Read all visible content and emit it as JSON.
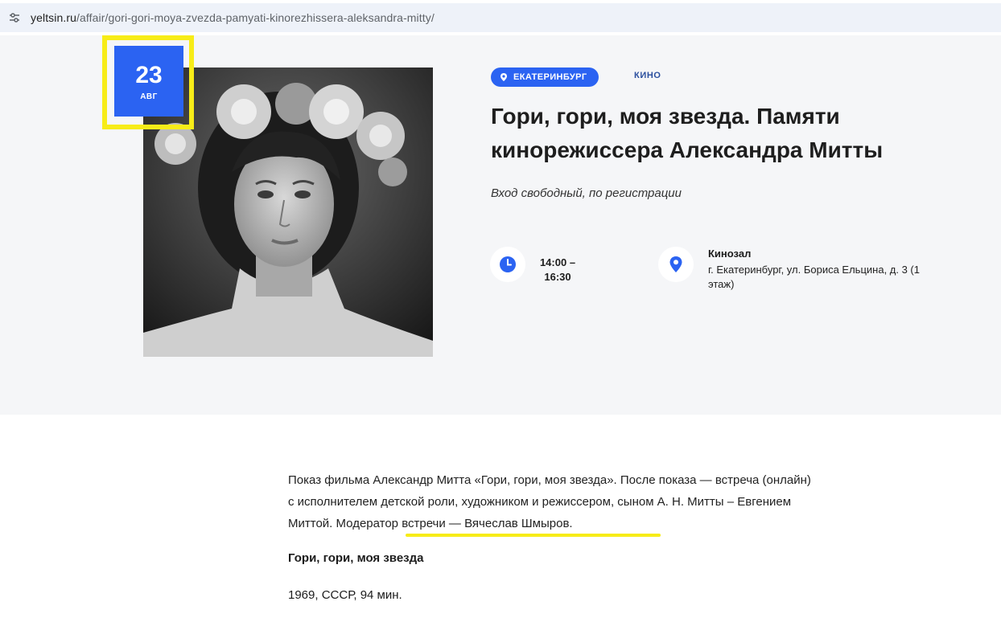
{
  "browser": {
    "url_host": "yeltsin.ru",
    "url_path": "/affair/gori-gori-moya-zvezda-pamyati-kinorezhissera-aleksandra-mitty/"
  },
  "event": {
    "date_day": "23",
    "date_month": "АВГ",
    "city_tag": "ЕКАТЕРИНБУРГ",
    "category": "КИНО",
    "title": "Гори, гори, моя звезда. Памяти кинорежиссера Александра Митты",
    "subtitle": "Вход свободный, по регистрации",
    "time_line1": "14:00 –",
    "time_line2": "16:30",
    "place_name": "Кинозал",
    "place_address": "г. Екатеринбург, ул. Бориса Ельцина, д. 3 (1 этаж)"
  },
  "content": {
    "description_start": "Показ фильма Александр Митта «Гори, гори, моя звезда». После показа — встреча (онлайн) с исполнителем детской роли, художником и режиссером, сыном А. Н. Митты – Евгением Миттой. ",
    "description_moderator": "Модератор встречи — Вячеслав Шмыров.",
    "film_title": "Гори, гори, моя звезда",
    "film_meta": "1969, СССР, 94 мин."
  },
  "colors": {
    "accent": "#2b63f2",
    "highlight": "#f7ec18",
    "hero_bg": "#f5f6f8"
  },
  "icons": [
    "site-settings-icon",
    "location-pin-icon",
    "clock-icon",
    "map-pin-icon"
  ]
}
